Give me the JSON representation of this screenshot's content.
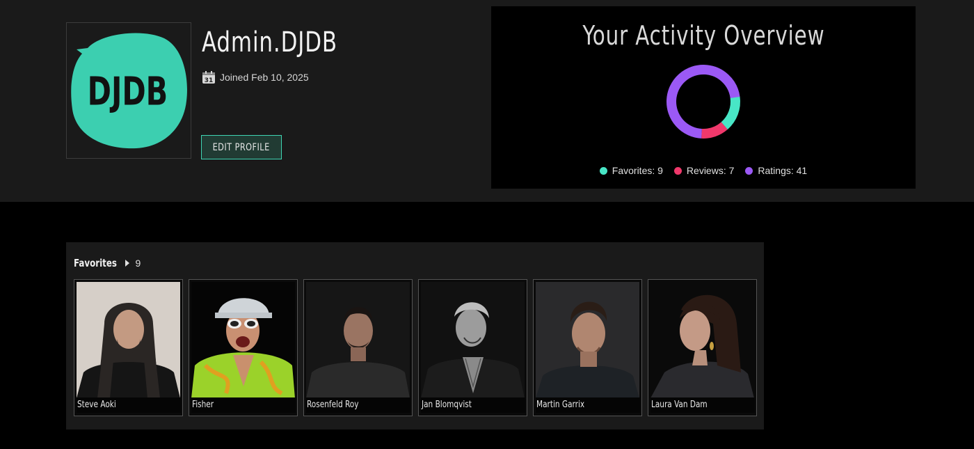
{
  "profile": {
    "username": "Admin.DJDB",
    "joined": "Joined Feb 10, 2025",
    "calendar_day": "31",
    "edit_label": "EDIT PROFILE",
    "avatar_text": "DJDB",
    "avatar_color": "#3ccfb0"
  },
  "activity": {
    "title": "Your Activity Overview",
    "legend": [
      {
        "label": "Favorites: 9",
        "color": "#48e6c6"
      },
      {
        "label": "Reviews: 7",
        "color": "#f0386b"
      },
      {
        "label": "Ratings: 41",
        "color": "#9b59f5"
      }
    ]
  },
  "chart_data": {
    "type": "pie",
    "title": "Your Activity Overview",
    "categories": [
      "Favorites",
      "Reviews",
      "Ratings"
    ],
    "values": [
      9,
      7,
      41
    ],
    "colors": [
      "#48e6c6",
      "#f0386b",
      "#9b59f5"
    ],
    "donut": true,
    "legend": "bottom"
  },
  "favorites": {
    "title": "Favorites",
    "count": "9",
    "items": [
      {
        "name": "Steve Aoki"
      },
      {
        "name": "Fisher"
      },
      {
        "name": "Rosenfeld Roy"
      },
      {
        "name": "Jan Blomqvist"
      },
      {
        "name": "Martin Garrix"
      },
      {
        "name": "Laura Van Dam"
      }
    ]
  }
}
